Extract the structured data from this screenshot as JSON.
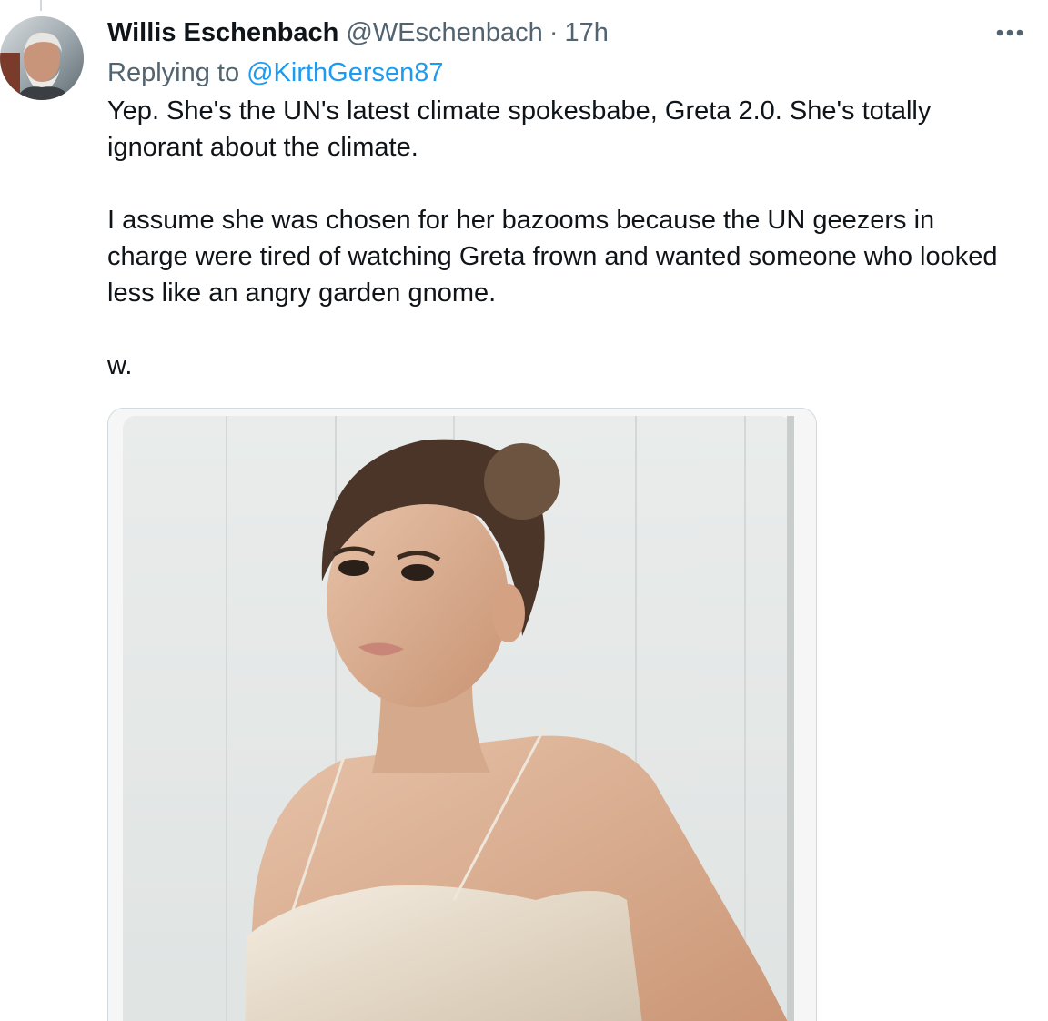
{
  "tweet": {
    "author": {
      "display_name": "Willis Eschenbach",
      "handle": "@WEschenbach"
    },
    "separator": "·",
    "time": "17h",
    "reply": {
      "prefix": "Replying to",
      "handle": "@KirthGersen87"
    },
    "paragraphs": [
      "Yep. She's the UN's latest climate spokesbabe, Greta 2.0. She's totally ignorant about the climate.",
      "I assume she was chosen for her bazooms because the UN geezers in charge were tired of watching Greta frown and wanted someone who looked less like an angry garden gnome.",
      "w."
    ]
  },
  "icons": {
    "more": "more-horizontal-icon",
    "avatar": "avatar-photo",
    "media": "attached-photo"
  },
  "colors": {
    "text_primary": "#0f1419",
    "text_secondary": "#536471",
    "link": "#1d9bf0",
    "border": "#cfd9de"
  }
}
